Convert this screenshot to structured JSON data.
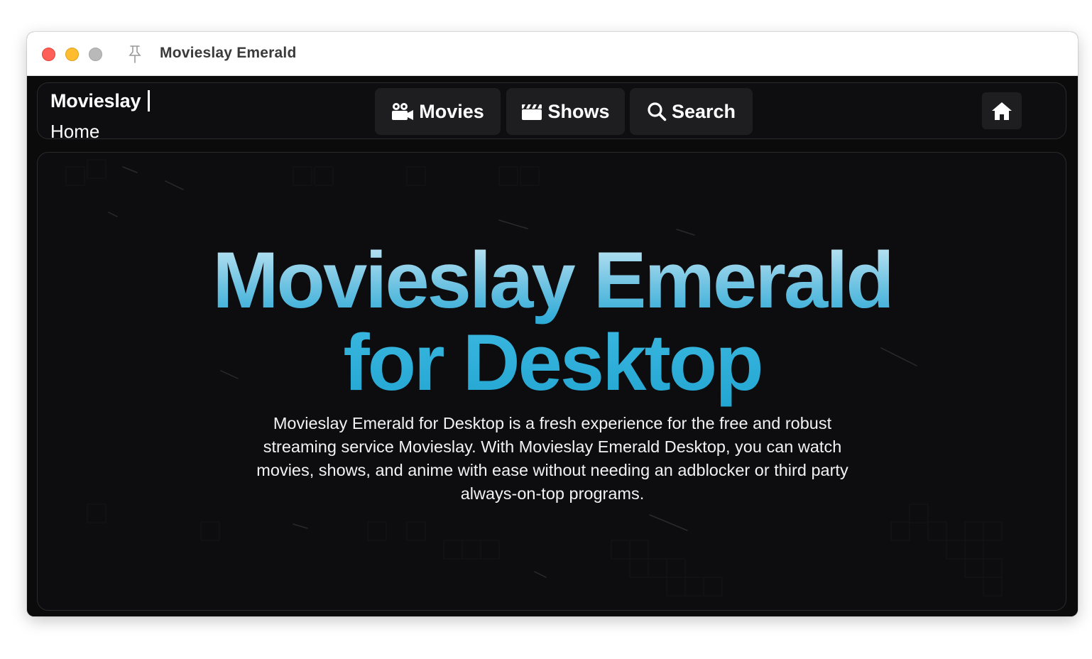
{
  "window": {
    "title": "Movieslay Emerald"
  },
  "titlebar_icons": {
    "close": "close-traffic-light",
    "minimize": "minimize-traffic-light",
    "zoom": "zoom-traffic-light",
    "pin": "pin-icon"
  },
  "navbar": {
    "brand_name": "Movieslay",
    "current_page": "Home",
    "buttons": [
      {
        "label": "Movies",
        "icon": "video-camera-icon"
      },
      {
        "label": "Shows",
        "icon": "clapperboard-icon"
      },
      {
        "label": "Search",
        "icon": "search-icon"
      }
    ],
    "home_icon": "home-icon"
  },
  "hero": {
    "headline_line1": "Movieslay Emerald",
    "headline_line2": "for Desktop",
    "description": "Movieslay Emerald for Desktop is a fresh experience for the free and robust streaming service Movieslay. With Movieslay Emerald Desktop, you can watch movies, shows, and anime with ease without needing an adblocker or third party always-on-top programs."
  },
  "colors": {
    "background": "#0b0b0c",
    "panel_border": "#2a2a2c",
    "button_bg": "#1e1e20",
    "accent_light": "#cdeaf6",
    "accent": "#2aa9d6",
    "close": "#fe5f57",
    "minimize": "#febc2e",
    "zoom": "#b9b9b9"
  }
}
